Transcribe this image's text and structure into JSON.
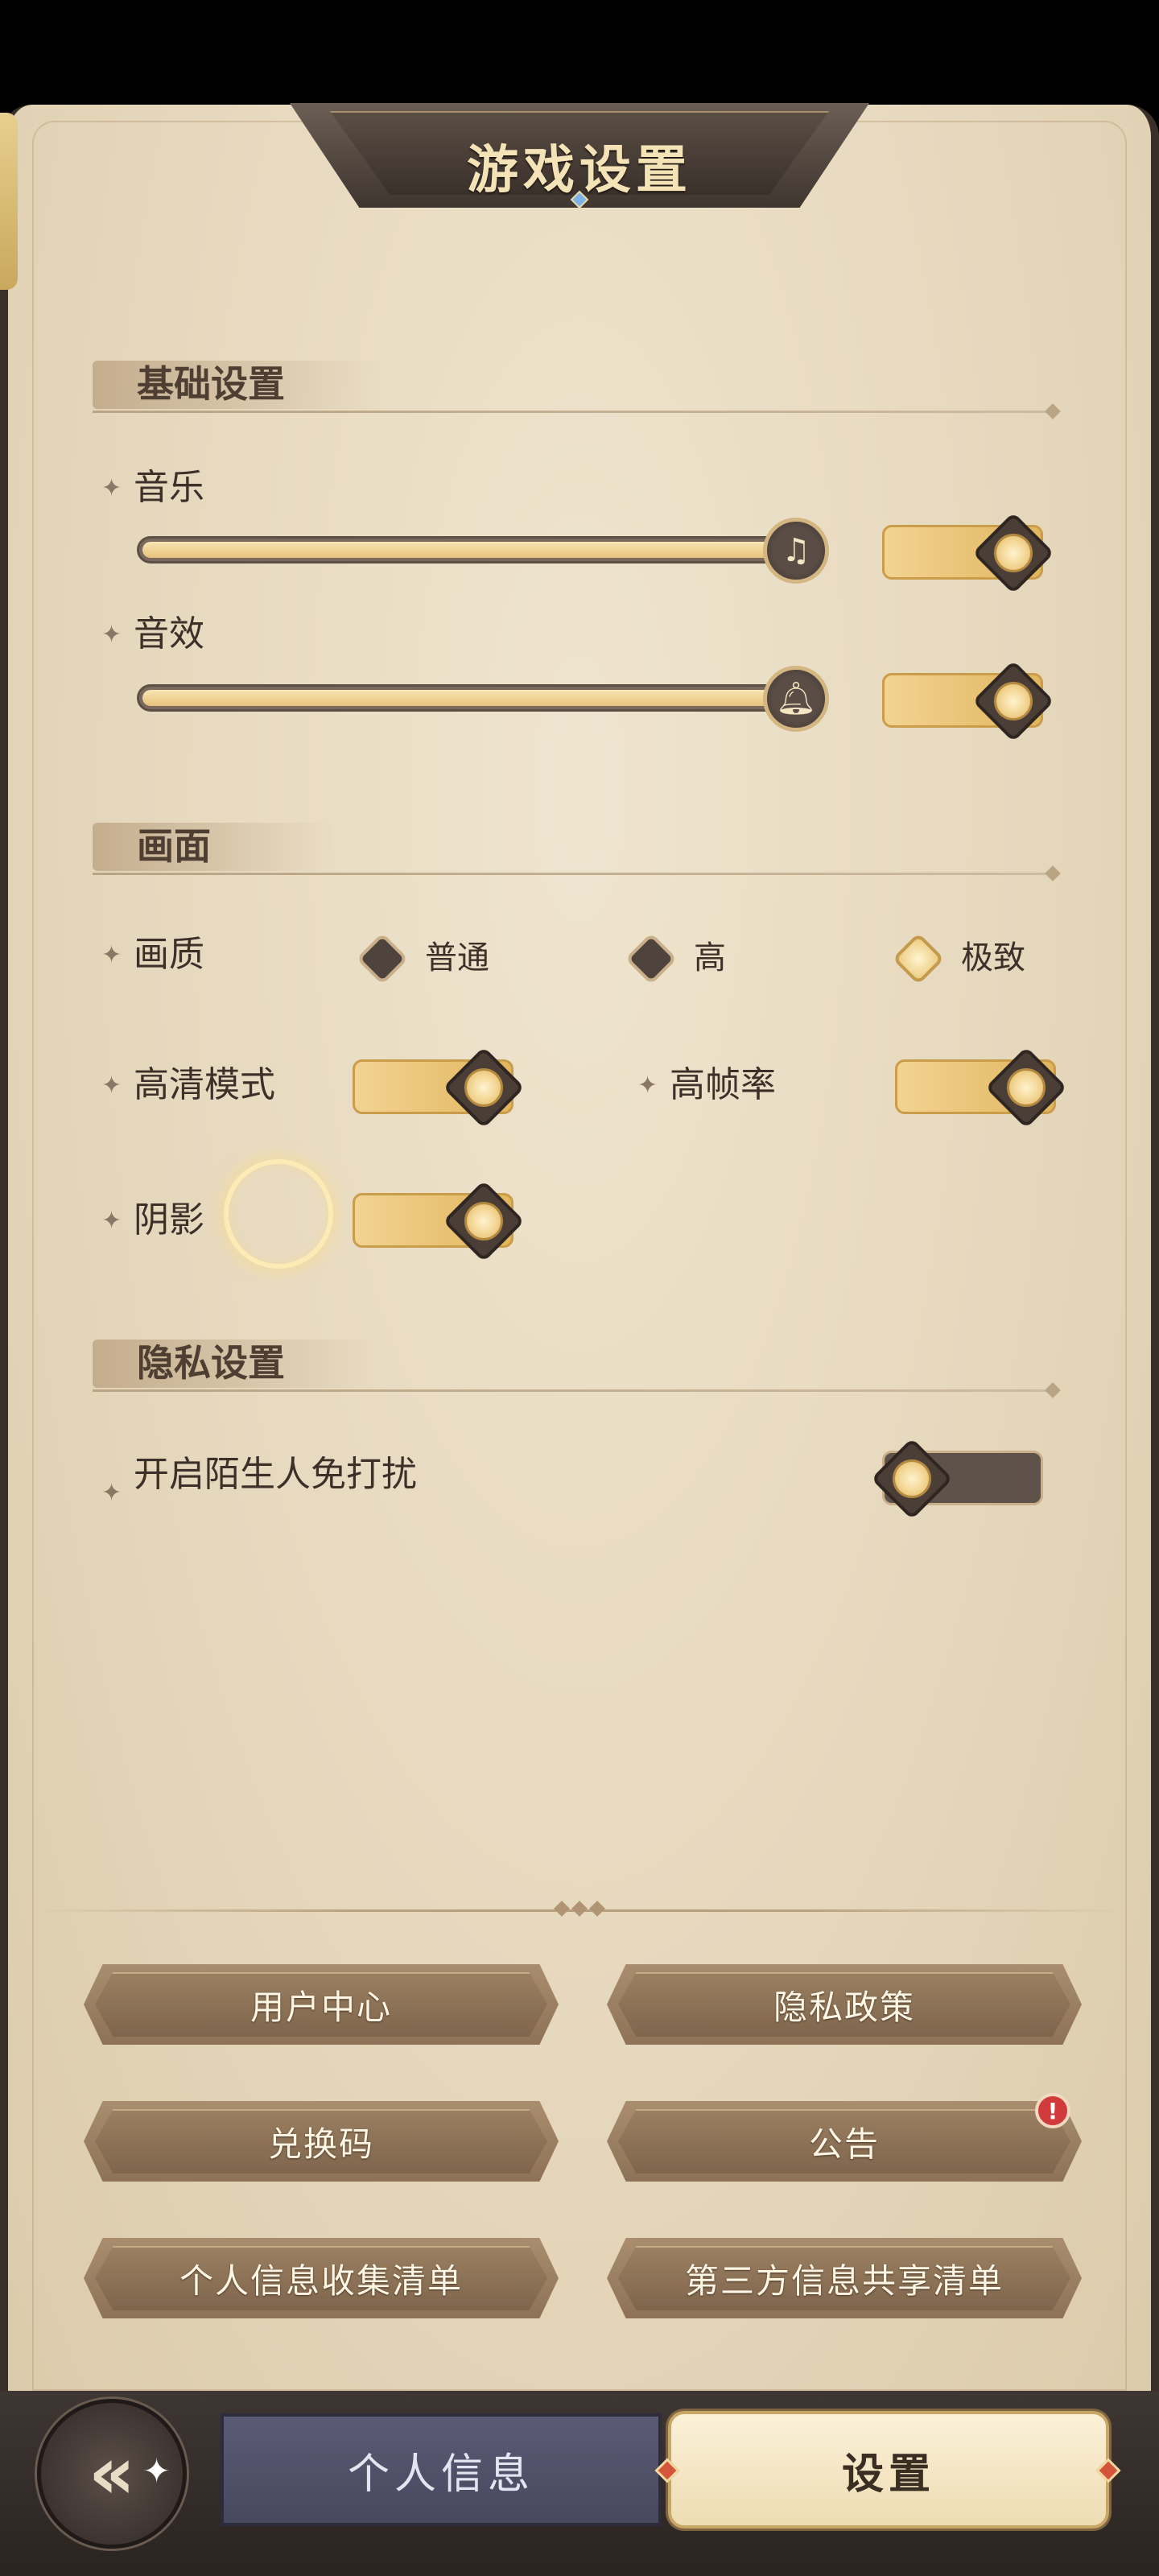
{
  "title": "游戏设置",
  "sections": {
    "basic": {
      "label": "基础设置"
    },
    "display": {
      "label": "画面"
    },
    "privacy": {
      "label": "隐私设置"
    }
  },
  "music": {
    "label": "音乐",
    "volume_percent": 100,
    "knob_icon": "music-note-icon",
    "enabled": true
  },
  "sfx": {
    "label": "音效",
    "volume_percent": 100,
    "knob_icon": "bell-icon",
    "enabled": true
  },
  "quality": {
    "label": "画质",
    "options": [
      {
        "label": "普通",
        "selected": false
      },
      {
        "label": "高",
        "selected": false
      },
      {
        "label": "极致",
        "selected": true
      }
    ]
  },
  "hd_mode": {
    "label": "高清模式",
    "enabled": true
  },
  "high_fps": {
    "label": "高帧率",
    "enabled": true
  },
  "shadow": {
    "label": "阴影",
    "enabled": true
  },
  "no_disturb": {
    "label": "开启陌生人免打扰",
    "enabled": false
  },
  "buttons": {
    "user_center": "用户中心",
    "privacy_policy": "隐私政策",
    "redeem_code": "兑换码",
    "announcement": "公告",
    "announcement_badge": "!",
    "personal_info_list": "个人信息收集清单",
    "third_party_list": "第三方信息共享清单"
  },
  "nav": {
    "personal_info": "个人信息",
    "settings": "设置",
    "active_tab": "设置"
  },
  "colors": {
    "panel_bg": "#e9dcc2",
    "toggle_on": "#e8c070",
    "toggle_off": "#5f524a",
    "button_bg": "#957a5d",
    "nav_info_bg": "#52526b",
    "nav_settings_bg": "#f5e7c6"
  }
}
